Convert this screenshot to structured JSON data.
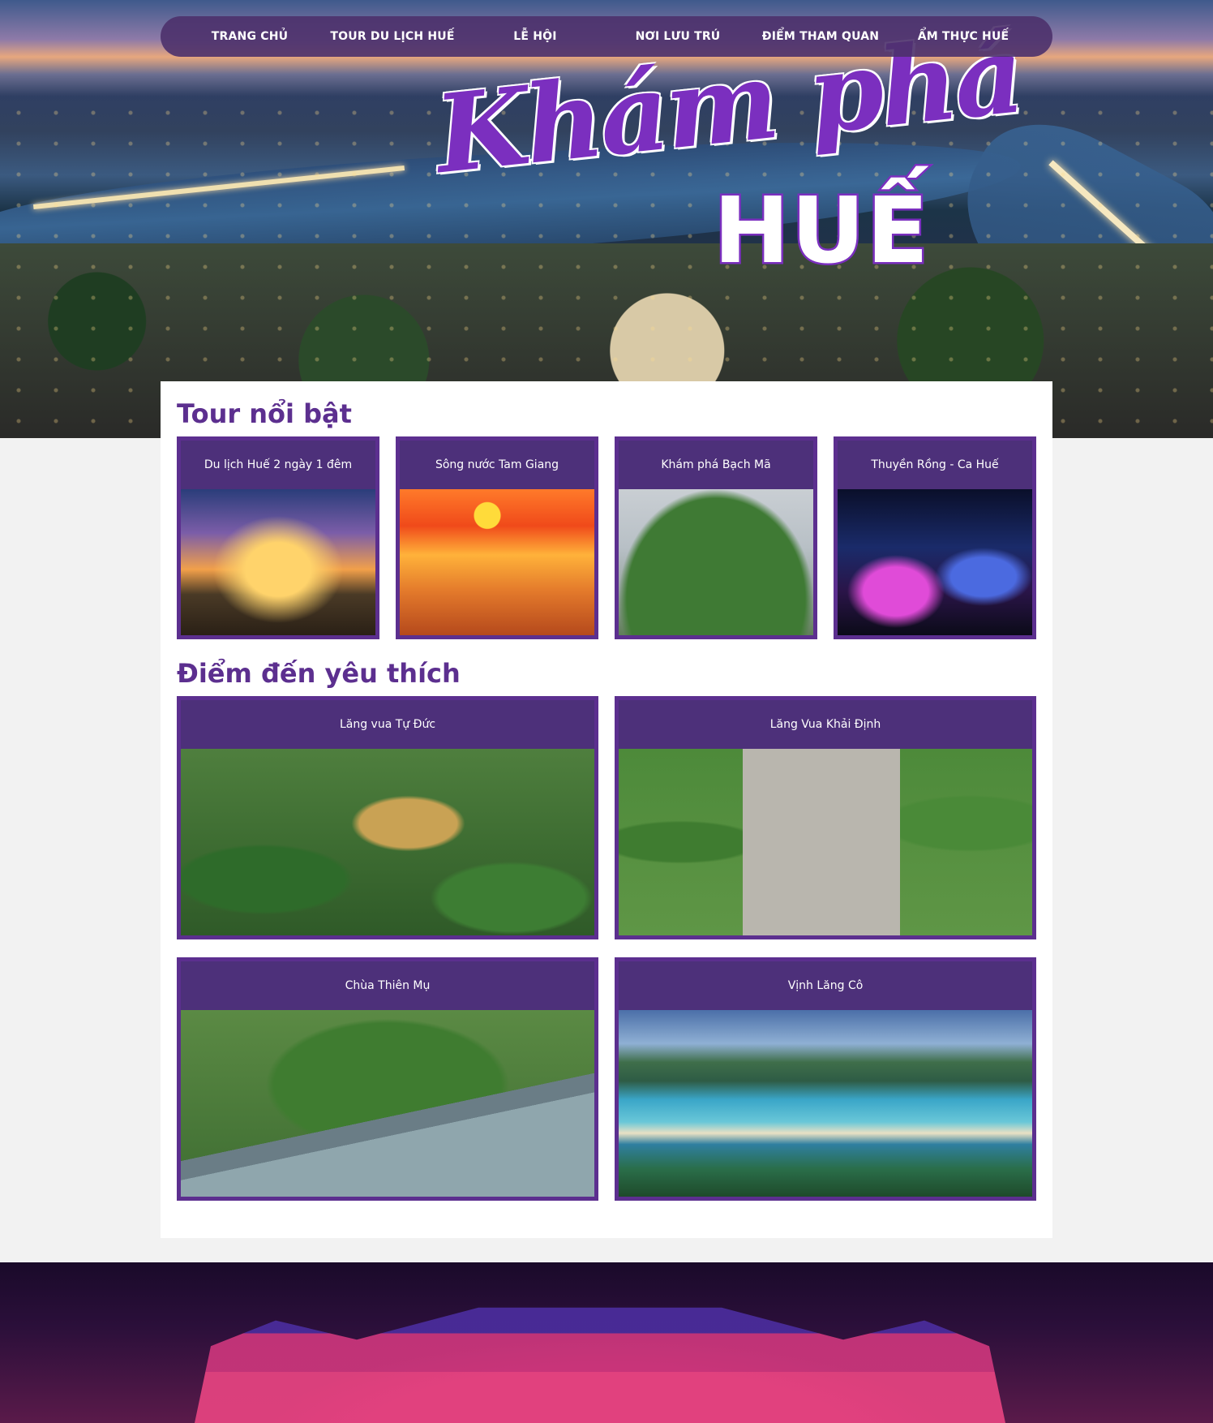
{
  "nav": {
    "items": [
      "TRANG CHỦ",
      "TOUR DU LỊCH HUẾ",
      "LỄ HỘI",
      "NƠI LƯU TRÚ",
      "ĐIỂM THAM QUAN",
      "ẨM THỰC HUẾ"
    ]
  },
  "logo": {
    "script": "Khám phá",
    "block": "HUẾ"
  },
  "tours": {
    "title": "Tour nổi bật",
    "items": [
      {
        "label": "Du lịch Huế 2 ngày 1 đêm"
      },
      {
        "label": "Sông nước Tam Giang"
      },
      {
        "label": "Khám phá Bạch Mã"
      },
      {
        "label": "Thuyền Rồng - Ca Huế"
      }
    ]
  },
  "destinations": {
    "title": "Điểm đến yêu thích",
    "items": [
      {
        "label": "Lăng vua Tự Đức"
      },
      {
        "label": "Lăng Vua Khải Định"
      },
      {
        "label": "Chùa Thiên Mụ"
      },
      {
        "label": "Vịnh Lăng Cô"
      }
    ]
  },
  "colors": {
    "accent": "#5c2f8f",
    "nav_bg": "#4c316c",
    "page_bg": "#f2f2f2"
  }
}
